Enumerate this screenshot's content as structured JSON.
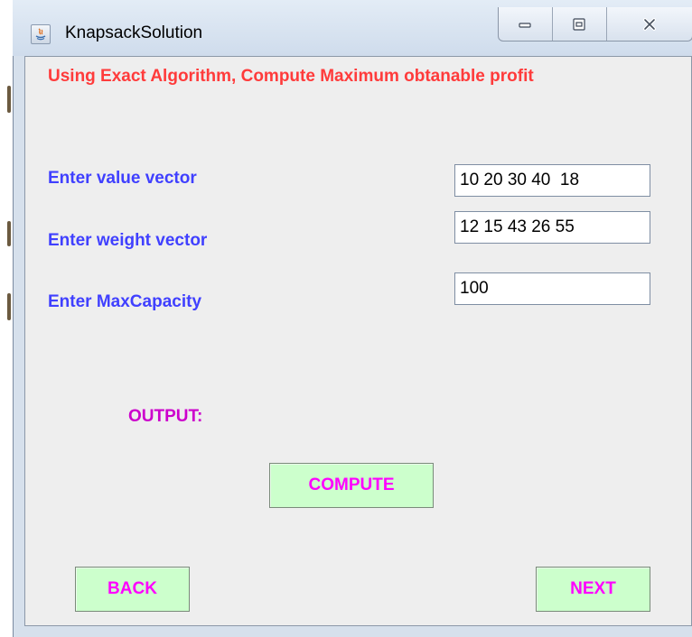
{
  "window": {
    "title": "KnapsackSolution",
    "app_icon": "java-icon",
    "minimize_icon": "minimize-icon",
    "maximize_icon": "maximize-icon",
    "close_icon": "close-icon"
  },
  "heading": "Using Exact Algorithm, Compute Maximum obtanable profit",
  "form": {
    "value_label": "Enter value vector",
    "value_input": "10 20 30 40  18",
    "weight_label": "Enter weight vector",
    "weight_input": "12 15 43 26 55",
    "capacity_label": "Enter MaxCapacity",
    "capacity_input": "100"
  },
  "output_label": "OUTPUT:",
  "buttons": {
    "compute": "COMPUTE",
    "back": "BACK",
    "next": "NEXT"
  },
  "colors": {
    "heading": "#ff3b3b",
    "labels": "#4040ff",
    "output_label": "#cc00cc",
    "button_bg": "#ccffcc",
    "button_text": "#ff00ff",
    "client_bg": "#eeeeee"
  }
}
